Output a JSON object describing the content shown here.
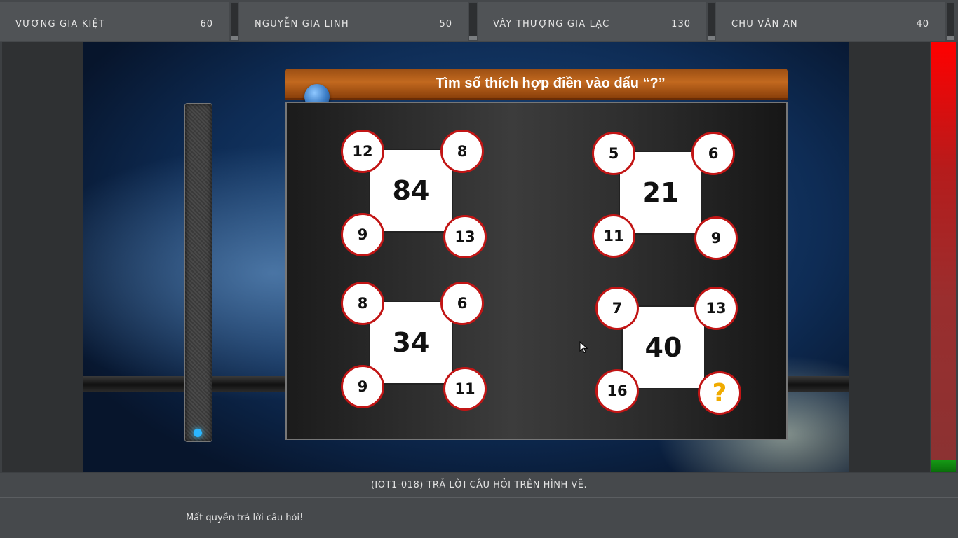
{
  "players": [
    {
      "name": "VƯƠNG GIA KIỆT",
      "score": "60"
    },
    {
      "name": "NGUYỄN GIA LINH",
      "score": "50"
    },
    {
      "name": "VÀY THƯỢNG GIA LẠC",
      "score": "130"
    },
    {
      "name": "CHU VĂN AN",
      "score": "40"
    }
  ],
  "question_image": {
    "title": "Tìm số thích hợp điền vào dấu “?”",
    "puzzles": [
      {
        "center": "84",
        "top_left": "12",
        "top_right": "8",
        "bottom_left": "9",
        "bottom_right": "13"
      },
      {
        "center": "21",
        "top_left": "5",
        "top_right": "6",
        "bottom_left": "11",
        "bottom_right": "9"
      },
      {
        "center": "34",
        "top_left": "8",
        "top_right": "6",
        "bottom_left": "9",
        "bottom_right": "11"
      },
      {
        "center": "40",
        "top_left": "7",
        "top_right": "13",
        "bottom_left": "16",
        "bottom_right": "?"
      }
    ]
  },
  "timer": {
    "remaining_fraction": 0.03,
    "top_color": "#ff0000",
    "remaining_color": "#169b16"
  },
  "question": {
    "code_text": "(IOT1-018) TRẢ LỜI CÂU HỎI TRÊN HÌNH VẼ.",
    "status_message": "Mất quyền trả lời câu hỏi!"
  },
  "icons": {
    "cursor": "mouse-pointer-icon",
    "knob": "blue-knob-icon",
    "light": "blue-indicator-light"
  }
}
